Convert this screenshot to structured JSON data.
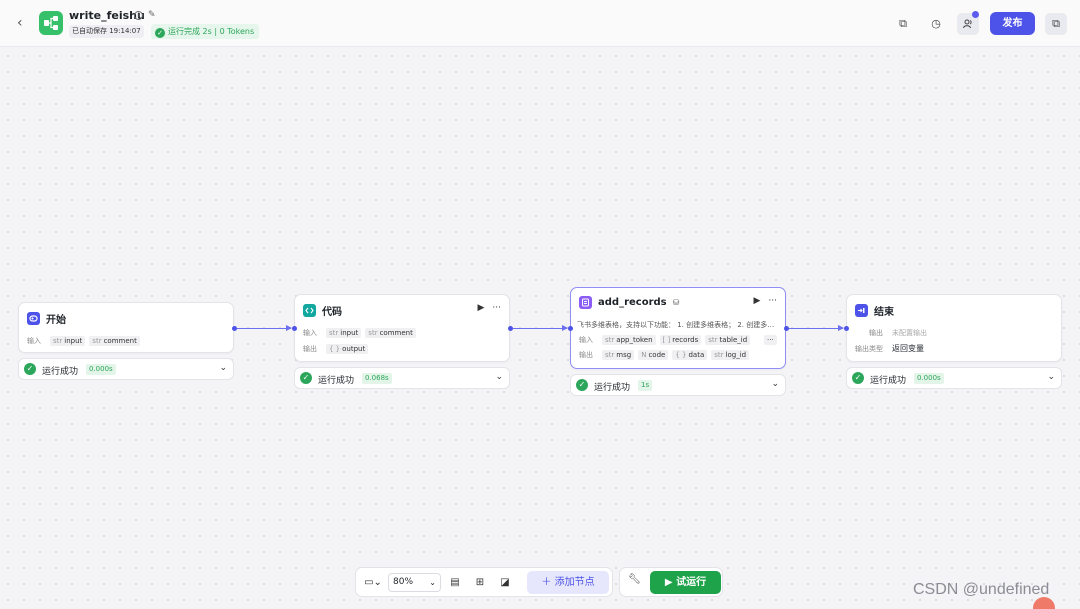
{
  "header": {
    "app_name": "write_feishu",
    "autosave": "已自动保存 19:14:07",
    "run_status": "运行完成 2s | 0 Tokens",
    "publish_label": "发布"
  },
  "nodes": {
    "start": {
      "title": "开始",
      "input_label": "输入",
      "inputs": [
        {
          "type": "str",
          "name": "input"
        },
        {
          "type": "str",
          "name": "comment"
        }
      ],
      "result_label": "运行成功",
      "result_time": "0.000s"
    },
    "code": {
      "title": "代码",
      "input_label": "输入",
      "output_label": "输出",
      "inputs": [
        {
          "type": "str",
          "name": "input"
        },
        {
          "type": "str",
          "name": "comment"
        }
      ],
      "outputs": [
        {
          "type": "{ }",
          "name": "output"
        }
      ],
      "result_label": "运行成功",
      "result_time": "0.068s"
    },
    "add_records": {
      "title": "add_records",
      "description": "飞书多维表格，支持以下功能： 1. 创建多维表格； 2. 创建多…",
      "input_label": "输入",
      "output_label": "输出",
      "inputs": [
        {
          "type": "str",
          "name": "app_token"
        },
        {
          "type": "[ ]",
          "name": "records"
        },
        {
          "type": "str",
          "name": "table_id"
        }
      ],
      "outputs": [
        {
          "type": "str",
          "name": "msg"
        },
        {
          "type": "N",
          "name": "code"
        },
        {
          "type": "{ }",
          "name": "data"
        },
        {
          "type": "str",
          "name": "log_id"
        }
      ],
      "result_label": "运行成功",
      "result_time": "1s"
    },
    "end": {
      "title": "结束",
      "output_label": "输出",
      "output_value": "未配置输出",
      "output_type_label": "输出类型",
      "output_type_value": "返回变量",
      "result_label": "运行成功",
      "result_time": "0.000s"
    }
  },
  "toolbar": {
    "zoom": "80%",
    "add_node_label": "添加节点",
    "trial_run_label": "试运行"
  },
  "watermark": "CSDN @undefined"
}
